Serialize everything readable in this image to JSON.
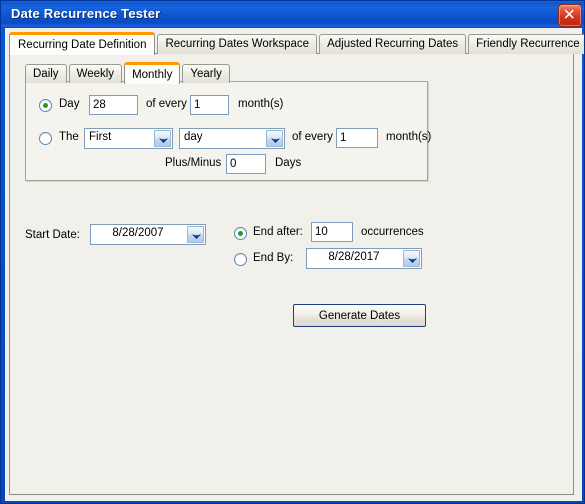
{
  "window": {
    "title": "Date Recurrence Tester",
    "close_icon": "close-icon"
  },
  "tabs": [
    {
      "label": "Recurring Date Definition",
      "selected": true
    },
    {
      "label": "Recurring Dates Workspace",
      "selected": false
    },
    {
      "label": "Adjusted Recurring Dates",
      "selected": false
    },
    {
      "label": "Friendly Recurrence Info",
      "selected": false
    }
  ],
  "inner_tabs": [
    {
      "label": "Daily",
      "selected": false
    },
    {
      "label": "Weekly",
      "selected": false
    },
    {
      "label": "Monthly",
      "selected": true
    },
    {
      "label": "Yearly",
      "selected": false
    }
  ],
  "monthly": {
    "day_option_label": "Day",
    "day_value": "28",
    "day_of_every_label": "of every",
    "day_interval_value": "1",
    "day_months_label": "month(s)",
    "the_option_label": "The",
    "ordinal_value": "First",
    "unit_value": "day",
    "the_of_every_label": "of every",
    "the_interval_value": "1",
    "the_months_label": "month(s)",
    "plus_minus_label": "Plus/Minus",
    "plus_minus_value": "0",
    "days_label": "Days"
  },
  "range": {
    "start_date_label": "Start Date:",
    "start_date_value": "8/28/2007",
    "end_after_label": "End after:",
    "end_after_value": "10",
    "occurrences_label": "occurrences",
    "end_by_label": "End By:",
    "end_by_value": "8/28/2017"
  },
  "actions": {
    "generate_label": "Generate Dates"
  },
  "colors": {
    "title_bar": "#0f56cc",
    "selected_tab_accent": "#ff9900",
    "client_background": "#f1f0ea",
    "radio_selected_dot": "#1e9e1e",
    "close_button": "#cf2d16",
    "default_button_border": "#1f3c80"
  }
}
